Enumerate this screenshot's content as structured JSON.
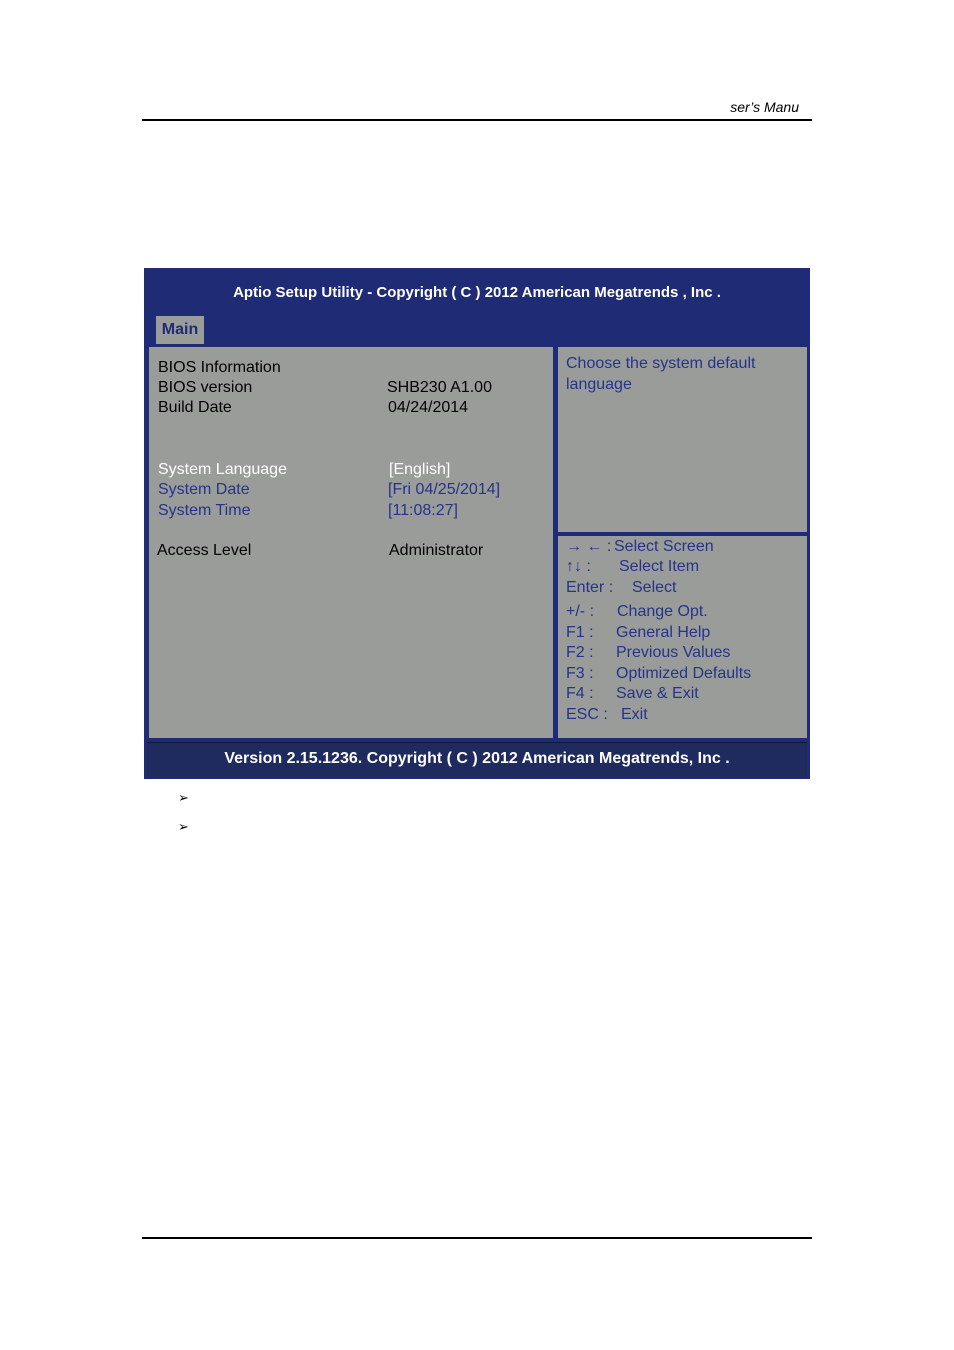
{
  "page_header": {
    "text": "ser’s Manu"
  },
  "bios": {
    "title": "Aptio Setup Utility - Copyright ( C ) 2012 American Megatrends , Inc .",
    "tabs": [
      {
        "label": "Main",
        "active": true
      }
    ],
    "info_rows": [
      {
        "label": "BIOS Information",
        "value": ""
      },
      {
        "label": "BIOS version",
        "value": "SHB230 A1.00"
      },
      {
        "label": "Build Date",
        "value": "04/24/2014"
      }
    ],
    "settings": [
      {
        "label": "System Language",
        "value": "[English]",
        "selected": true
      },
      {
        "label": "System Date",
        "value": "[Fri 04/25/2014]",
        "selected": false
      },
      {
        "label": "System Time",
        "value": "[11:08:27]",
        "selected": false
      }
    ],
    "access": {
      "label": "Access Level",
      "value": "Administrator"
    },
    "help_text": "Choose the system default language",
    "keys": [
      {
        "key": "→ ← :",
        "desc": "Select Screen"
      },
      {
        "key": "↑↓  :",
        "desc": "Select Item"
      },
      {
        "key": "Enter  :",
        "desc": "Select"
      },
      {
        "key": "+/- :",
        "desc": "Change Opt."
      },
      {
        "key": "F1 :",
        "desc": "General Help"
      },
      {
        "key": "F2 :",
        "desc": "Previous Values"
      },
      {
        "key": "F3 :",
        "desc": "Optimized Defaults"
      },
      {
        "key": "F4 :",
        "desc": "Save & Exit"
      },
      {
        "key": "ESC :",
        "desc": "Exit"
      }
    ],
    "footer": "Version 2.15.1236. Copyright ( C ) 2012 American Megatrends, Inc .",
    "colors": {
      "frame": "#1f2b74",
      "panel": "#9a9c9a",
      "highlight_text": "#ffffff",
      "option_text": "#26338a"
    }
  },
  "bullets": [
    {
      "glyph": "➢"
    },
    {
      "glyph": "➢"
    }
  ]
}
